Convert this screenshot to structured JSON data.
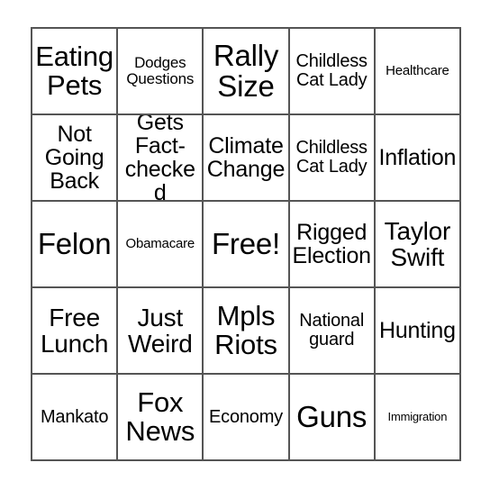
{
  "card": {
    "kind": "bingo-card",
    "rows": 5,
    "columns": 5,
    "background_color": "#ffffff",
    "border_color": "#555555",
    "text_color": "#000000",
    "cells": [
      {
        "text": "Eating\nPets",
        "size": "s-xl",
        "marked": false
      },
      {
        "text": "Dodges\nQuestions",
        "size": "s-xs",
        "marked": false
      },
      {
        "text": "Rally\nSize",
        "size": "s-xxl",
        "marked": false
      },
      {
        "text": "Childless\nCat Lady",
        "size": "s-sm",
        "marked": false
      },
      {
        "text": "Healthcare",
        "size": "s-xxs",
        "marked": false
      },
      {
        "text": "Not\nGoing\nBack",
        "size": "s-md",
        "marked": false
      },
      {
        "text": "Gets\nFact-\nchecked",
        "size": "s-md",
        "marked": false
      },
      {
        "text": "Climate\nChange",
        "size": "s-md",
        "marked": false
      },
      {
        "text": "Childless\nCat Lady",
        "size": "s-sm",
        "marked": false
      },
      {
        "text": "Inflation",
        "size": "s-md",
        "marked": false
      },
      {
        "text": "Felon",
        "size": "s-xxl",
        "marked": false
      },
      {
        "text": "Obamacare",
        "size": "s-xxs",
        "marked": false
      },
      {
        "text": "Free!",
        "size": "s-xxl",
        "marked": false
      },
      {
        "text": "Rigged\nElection",
        "size": "s-md",
        "marked": false
      },
      {
        "text": "Taylor\nSwift",
        "size": "s-lg",
        "marked": false
      },
      {
        "text": "Free\nLunch",
        "size": "s-lg",
        "marked": false
      },
      {
        "text": "Just\nWeird",
        "size": "s-lg",
        "marked": false
      },
      {
        "text": "Mpls\nRiots",
        "size": "s-xl",
        "marked": false
      },
      {
        "text": "National\nguard",
        "size": "s-sm",
        "marked": false
      },
      {
        "text": "Hunting",
        "size": "s-md",
        "marked": false
      },
      {
        "text": "Mankato",
        "size": "s-sm",
        "marked": false
      },
      {
        "text": "Fox\nNews",
        "size": "s-xl",
        "marked": false
      },
      {
        "text": "Economy",
        "size": "s-sm",
        "marked": false
      },
      {
        "text": "Guns",
        "size": "s-xxl",
        "marked": false
      },
      {
        "text": "Immigration",
        "size": "s-tiny",
        "marked": false
      }
    ]
  }
}
